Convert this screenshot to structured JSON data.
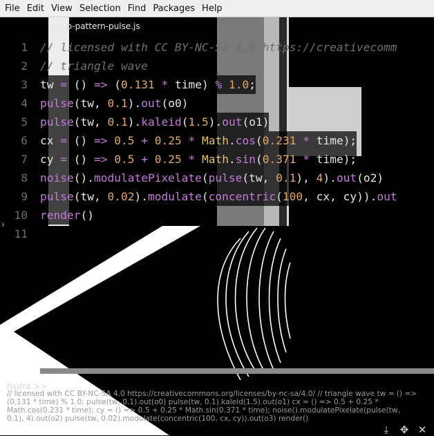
{
  "menu": [
    "File",
    "Edit",
    "View",
    "Selection",
    "Find",
    "Packages",
    "Help"
  ],
  "tab": {
    "title": "demo-pattern-pulse.js"
  },
  "editor": {
    "line_numbers": [
      "1",
      "2",
      "3",
      "4",
      "5",
      "6",
      "7",
      "8",
      "9",
      "10",
      "11"
    ],
    "lines": [
      [
        {
          "t": "// licensed with CC BY-NC-SA 4.0 ",
          "c": "cm"
        },
        {
          "t": "https://creativecomm",
          "c": "url"
        }
      ],
      [
        {
          "t": "// triangle wave",
          "c": "cm"
        }
      ],
      [
        {
          "t": "tw",
          "c": "id"
        },
        {
          "t": " = ",
          "c": "op"
        },
        {
          "t": "() ",
          "c": "pn"
        },
        {
          "t": "=>",
          "c": "op"
        },
        {
          "t": " (",
          "c": "pn"
        },
        {
          "t": "0.131",
          "c": "nm"
        },
        {
          "t": " * ",
          "c": "op"
        },
        {
          "t": "time",
          "c": "id"
        },
        {
          "t": ") ",
          "c": "pn"
        },
        {
          "t": "%",
          "c": "op"
        },
        {
          "t": " ",
          "c": "pn"
        },
        {
          "t": "1.0",
          "c": "nm"
        },
        {
          "t": ";",
          "c": "pn"
        }
      ],
      [
        {
          "t": "pulse",
          "c": "fn"
        },
        {
          "t": "(tw, ",
          "c": "pn"
        },
        {
          "t": "0.1",
          "c": "nm"
        },
        {
          "t": ").",
          "c": "pn"
        },
        {
          "t": "out",
          "c": "pr"
        },
        {
          "t": "(o0)",
          "c": "pn"
        }
      ],
      [
        {
          "t": "pulse",
          "c": "fn"
        },
        {
          "t": "(tw, ",
          "c": "pn"
        },
        {
          "t": "0.1",
          "c": "nm"
        },
        {
          "t": ").",
          "c": "pn"
        },
        {
          "t": "kaleid",
          "c": "pr"
        },
        {
          "t": "(",
          "c": "pn"
        },
        {
          "t": "1.5",
          "c": "nm"
        },
        {
          "t": ").",
          "c": "pn"
        },
        {
          "t": "out",
          "c": "pr"
        },
        {
          "t": "(o1)",
          "c": "pn"
        }
      ],
      [
        {
          "t": "cx",
          "c": "id"
        },
        {
          "t": " = ",
          "c": "op"
        },
        {
          "t": "() ",
          "c": "pn"
        },
        {
          "t": "=>",
          "c": "op"
        },
        {
          "t": " ",
          "c": "pn"
        },
        {
          "t": "0.5",
          "c": "nm"
        },
        {
          "t": " + ",
          "c": "op"
        },
        {
          "t": "0.25",
          "c": "nm"
        },
        {
          "t": " * ",
          "c": "op"
        },
        {
          "t": "Math",
          "c": "mth"
        },
        {
          "t": ".",
          "c": "pn"
        },
        {
          "t": "cos",
          "c": "pr"
        },
        {
          "t": "(",
          "c": "pn"
        },
        {
          "t": "0.231",
          "c": "nm"
        },
        {
          "t": " * ",
          "c": "op"
        },
        {
          "t": "time",
          "c": "id"
        },
        {
          "t": ");",
          "c": "pn"
        }
      ],
      [
        {
          "t": "cy",
          "c": "id"
        },
        {
          "t": " = ",
          "c": "op"
        },
        {
          "t": "() ",
          "c": "pn"
        },
        {
          "t": "=>",
          "c": "op"
        },
        {
          "t": " ",
          "c": "pn"
        },
        {
          "t": "0.5",
          "c": "nm"
        },
        {
          "t": " + ",
          "c": "op"
        },
        {
          "t": "0.25",
          "c": "nm"
        },
        {
          "t": " * ",
          "c": "op"
        },
        {
          "t": "Math",
          "c": "mth"
        },
        {
          "t": ".",
          "c": "pn"
        },
        {
          "t": "sin",
          "c": "pr"
        },
        {
          "t": "(",
          "c": "pn"
        },
        {
          "t": "0.371",
          "c": "nm"
        },
        {
          "t": " * ",
          "c": "op"
        },
        {
          "t": "time",
          "c": "id"
        },
        {
          "t": ");",
          "c": "pn"
        }
      ],
      [
        {
          "t": "noise",
          "c": "fn"
        },
        {
          "t": "().",
          "c": "pn"
        },
        {
          "t": "modulatePixelate",
          "c": "pr"
        },
        {
          "t": "(",
          "c": "pn"
        },
        {
          "t": "pulse",
          "c": "fn"
        },
        {
          "t": "(tw, ",
          "c": "pn"
        },
        {
          "t": "0.1",
          "c": "nm"
        },
        {
          "t": "), ",
          "c": "pn"
        },
        {
          "t": "4",
          "c": "nm"
        },
        {
          "t": ").",
          "c": "pn"
        },
        {
          "t": "out",
          "c": "pr"
        },
        {
          "t": "(o2)",
          "c": "pn"
        }
      ],
      [
        {
          "t": "pulse",
          "c": "fn"
        },
        {
          "t": "(tw, ",
          "c": "pn"
        },
        {
          "t": "0.02",
          "c": "nm"
        },
        {
          "t": ").",
          "c": "pn"
        },
        {
          "t": "modulate",
          "c": "pr"
        },
        {
          "t": "(",
          "c": "pn"
        },
        {
          "t": "concentric",
          "c": "fn"
        },
        {
          "t": "(",
          "c": "pn"
        },
        {
          "t": "100",
          "c": "nm"
        },
        {
          "t": ", cx, cy)).",
          "c": "pn"
        },
        {
          "t": "out",
          "c": "pr"
        }
      ],
      [
        {
          "t": "render",
          "c": "fn"
        },
        {
          "t": "()",
          "c": "pn"
        }
      ],
      []
    ]
  },
  "console": {
    "label": "hydra >>",
    "text": "// licensed with CC BY-NC-SA 4.0 https://creativecommons.org/licenses/by-nc-sa/4.0/ // triangle wave tw = () => (0.131 * time) % 1.0; pulse(tw, 0.1).out(o0) pulse(tw, 0.1).kaleid(1.5).out(o1) cx = () => 0.5 + 0.25 * Math.cos(0.231 * time); cy = () => 0.5 + 0.25 * Math.sin(0.371 * time); noise().modulatePixelate(pulse(tw, 0.1), 4).out(o2) pulse(tw, 0.02).modulate(concentric(100, cx, cy)).out(o3) render()"
  },
  "colors": {
    "comment": "#6f6f6f",
    "function": "#c47ad8",
    "number": "#e3a76b",
    "math": "#e7c06b",
    "text": "#e6e6e6"
  }
}
